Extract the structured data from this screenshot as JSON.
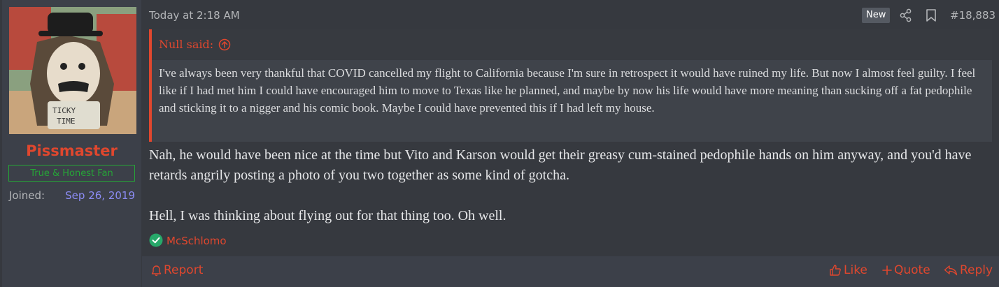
{
  "user": {
    "name": "Pissmaster",
    "title": "True & Honest Fan",
    "joined_label": "Joined:",
    "joined_date": "Sep 26, 2019",
    "avatar_text": "TICKY TIME"
  },
  "post": {
    "timestamp": "Today at 2:18 AM",
    "badge": "New",
    "number": "#18,883"
  },
  "quote": {
    "author": "Null said:",
    "text": "I've always been very thankful that COVID cancelled my flight to California because I'm sure in retrospect it would have ruined my life. But now I almost feel guilty. I feel like if I had met him I could have encouraged him to move to Texas like he planned, and maybe by now his life would have more meaning than sucking off a fat pedophile and sticking it to a nigger and his comic book. Maybe I could have prevented this if I had left my house."
  },
  "message": {
    "paragraph1": "Nah, he would have been nice at the time but Vito and Karson would get their greasy cum-stained pedophile hands on him anyway, and you'd have retards angrily posting a photo of you two together as some kind of gotcha.",
    "paragraph2": "Hell, I was thinking about flying out for that thing too. Oh well."
  },
  "reactions": {
    "user": "McSchlomo"
  },
  "footer": {
    "report": "Report",
    "like": "Like",
    "quote": "Quote",
    "reply": "Reply"
  },
  "colors": {
    "accent": "#e0472e",
    "title_green": "#26a537",
    "joined_date": "#8c8cf5",
    "background": "#36393f"
  },
  "icons": [
    "share-icon",
    "bookmark-icon",
    "quote-jump-icon",
    "check-reaction-icon",
    "bell-icon",
    "thumbs-up-icon",
    "plus-icon",
    "reply-icon"
  ]
}
